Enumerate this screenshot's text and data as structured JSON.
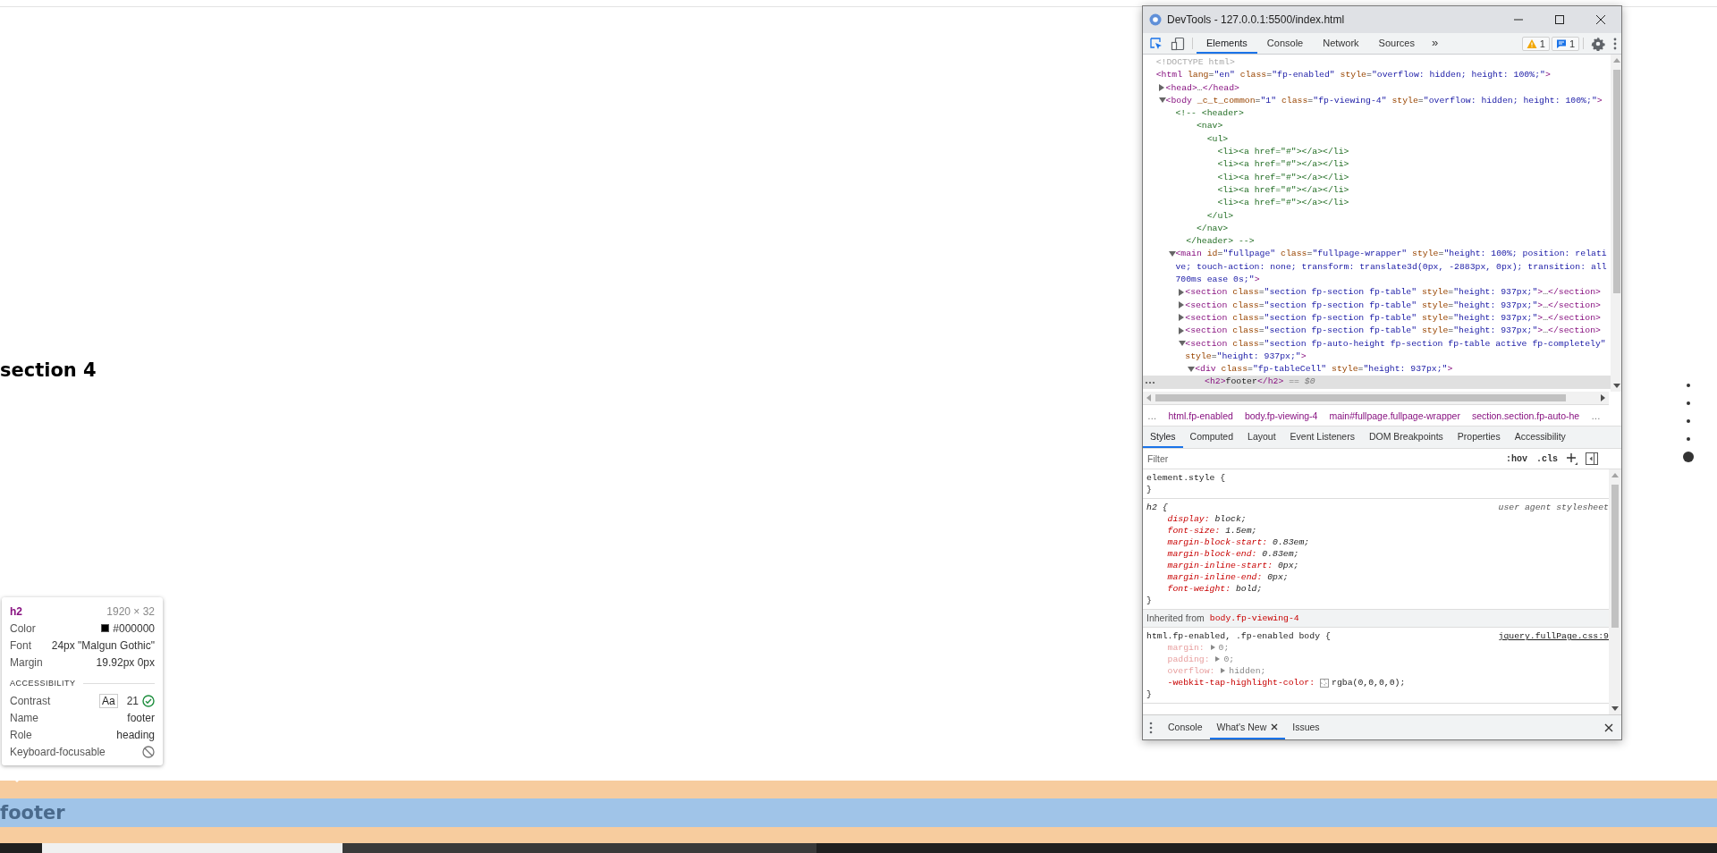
{
  "page": {
    "heading": "section 4",
    "footer": "footer",
    "nav_dots": [
      {
        "selected": false
      },
      {
        "selected": false
      },
      {
        "selected": false
      },
      {
        "selected": false
      },
      {
        "selected": true
      }
    ]
  },
  "tooltip": {
    "tag": "h2",
    "size": "1920 × 32",
    "rows": [
      {
        "label": "Color",
        "value": "#000000",
        "kind": "color"
      },
      {
        "label": "Font",
        "value": "24px \"Malgun Gothic\"",
        "kind": "text"
      },
      {
        "label": "Margin",
        "value": "19.92px 0px",
        "kind": "text"
      }
    ],
    "section": "ACCESSIBILITY",
    "a11y": [
      {
        "label": "Contrast",
        "kind": "contrast",
        "sample": "Aa",
        "value": "21"
      },
      {
        "label": "Name",
        "kind": "text",
        "value": "footer"
      },
      {
        "label": "Role",
        "kind": "text",
        "value": "heading"
      },
      {
        "label": "Keyboard-focusable",
        "kind": "blocked"
      }
    ]
  },
  "devtools": {
    "title": "DevTools - 127.0.0.1:5500/index.html",
    "tabs": [
      {
        "label": "Elements",
        "selected": true
      },
      {
        "label": "Console",
        "selected": false
      },
      {
        "label": "Network",
        "selected": false
      },
      {
        "label": "Sources",
        "selected": false
      }
    ],
    "more_tabs": "»",
    "badges": [
      {
        "kind": "warning",
        "count": "1"
      },
      {
        "kind": "message",
        "count": "1"
      }
    ],
    "dom_tree": [
      {
        "kind": "doctype",
        "text": "<!DOCTYPE html>",
        "selected": false
      },
      {
        "kind": "element",
        "text": "<html lang=\"en\" class=\"fp-enabled\" style=\"overflow: hidden; height: 100%;\">",
        "selected": false,
        "children": [
          {
            "kind": "element",
            "text": "<head>…</head>",
            "expanded": false,
            "selected": false
          },
          {
            "kind": "element",
            "text": "<body _c_t_common=\"1\" class=\"fp-viewing-4\" style=\"overflow: hidden; height: 100%;\">",
            "expanded": true,
            "selected": false,
            "children": [
              {
                "kind": "comment",
                "selected": false,
                "lines": [
                  "<!-- <header>",
                  "    <nav>",
                  "      <ul>",
                  "        <li><a href=\"#\"></a></li>",
                  "        <li><a href=\"#\"></a></li>",
                  "        <li><a href=\"#\"></a></li>",
                  "        <li><a href=\"#\"></a></li>",
                  "        <li><a href=\"#\"></a></li>",
                  "      </ul>",
                  "    </nav>",
                  "  </header> -->"
                ]
              },
              {
                "kind": "element",
                "text": "<main id=\"fullpage\" class=\"fullpage-wrapper\" style=\"height: 100%; position: relative; touch-action: none; transform: translate3d(0px, -2883px, 0px); transition: all 700ms ease 0s;\">",
                "expanded": true,
                "selected": false,
                "children": [
                  {
                    "kind": "element",
                    "text": "<section class=\"section fp-section fp-table\" style=\"height: 937px;\">…</section>",
                    "expanded": false,
                    "selected": false
                  },
                  {
                    "kind": "element",
                    "text": "<section class=\"section fp-section fp-table\" style=\"height: 937px;\">…</section>",
                    "expanded": false,
                    "selected": false
                  },
                  {
                    "kind": "element",
                    "text": "<section class=\"section fp-section fp-table\" style=\"height: 937px;\">…</section>",
                    "expanded": false,
                    "selected": false
                  },
                  {
                    "kind": "element",
                    "text": "<section class=\"section fp-section fp-table\" style=\"height: 937px;\">…</section>",
                    "expanded": false,
                    "selected": false
                  },
                  {
                    "kind": "element",
                    "text": "<section class=\"section fp-auto-height fp-section fp-table active fp-completely\" style=\"height: 937px;\">",
                    "expanded": true,
                    "selected": false,
                    "children": [
                      {
                        "kind": "element",
                        "text": "<div class=\"fp-tableCell\" style=\"height: 937px;\">",
                        "expanded": true,
                        "selected": false,
                        "children": [
                          {
                            "kind": "element",
                            "text": "<h2>footer</h2>",
                            "selected": true,
                            "marker": "== $0"
                          }
                        ]
                      }
                    ]
                  }
                ]
              }
            ]
          }
        ]
      }
    ],
    "breadcrumbs": [
      {
        "kind": "more",
        "text": "…"
      },
      {
        "kind": "crumb",
        "text": "html.fp-enabled"
      },
      {
        "kind": "crumb",
        "text": "body.fp-viewing-4"
      },
      {
        "kind": "crumb",
        "text": "main#fullpage.fullpage-wrapper"
      },
      {
        "kind": "crumb",
        "text": "section.section.fp-auto-he"
      },
      {
        "kind": "more",
        "text": "…"
      }
    ],
    "styles_tabs": [
      {
        "label": "Styles",
        "selected": true
      },
      {
        "label": "Computed",
        "selected": false
      },
      {
        "label": "Layout",
        "selected": false
      },
      {
        "label": "Event Listeners",
        "selected": false
      },
      {
        "label": "DOM Breakpoints",
        "selected": false
      },
      {
        "label": "Properties",
        "selected": false
      },
      {
        "label": "Accessibility",
        "selected": false
      }
    ],
    "filter": {
      "placeholder": "Filter"
    },
    "filter_buttons": [
      ":hov",
      ".cls"
    ],
    "rules": [
      {
        "kind": "rule",
        "selector": "element.style {",
        "user_agent": false,
        "close": "}"
      },
      {
        "kind": "rule",
        "selector": "h2 {",
        "source": "user agent stylesheet",
        "user_agent": true,
        "close": "}",
        "declarations": [
          {
            "name": "display:",
            "value": "block;",
            "inactive": false,
            "expandable": false,
            "swatch": false
          },
          {
            "name": "font-size:",
            "value": "1.5em;",
            "inactive": false,
            "expandable": false,
            "swatch": false
          },
          {
            "name": "margin-block-start:",
            "value": "0.83em;",
            "inactive": false,
            "expandable": false,
            "swatch": false
          },
          {
            "name": "margin-block-end:",
            "value": "0.83em;",
            "inactive": false,
            "expandable": false,
            "swatch": false
          },
          {
            "name": "margin-inline-start:",
            "value": "0px;",
            "inactive": false,
            "expandable": false,
            "swatch": false
          },
          {
            "name": "margin-inline-end:",
            "value": "0px;",
            "inactive": false,
            "expandable": false,
            "swatch": false
          },
          {
            "name": "font-weight:",
            "value": "bold;",
            "inactive": false,
            "expandable": false,
            "swatch": false
          }
        ]
      },
      {
        "kind": "inherited",
        "label": "Inherited from",
        "from": "body.fp-viewing-4"
      },
      {
        "kind": "rule",
        "selector": "html.fp-enabled, .fp-enabled body {",
        "source": "jquery.fullPage.css:9",
        "user_agent": false,
        "close": "}",
        "declarations": [
          {
            "name": "margin:",
            "value": "0;",
            "inactive": true,
            "expandable": true,
            "swatch": false
          },
          {
            "name": "padding:",
            "value": "0;",
            "inactive": true,
            "expandable": true,
            "swatch": false
          },
          {
            "name": "overflow:",
            "value": "hidden;",
            "inactive": true,
            "expandable": true,
            "swatch": false
          },
          {
            "name": "-webkit-tap-highlight-color:",
            "value": "rgba(0,0,0,0);",
            "inactive": false,
            "expandable": false,
            "swatch": true
          }
        ]
      }
    ],
    "drawer": [
      {
        "label": "Console",
        "selected": false,
        "closable": false
      },
      {
        "label": "What's New",
        "selected": true,
        "closable": true
      },
      {
        "label": "Issues",
        "selected": false,
        "closable": false
      }
    ]
  }
}
